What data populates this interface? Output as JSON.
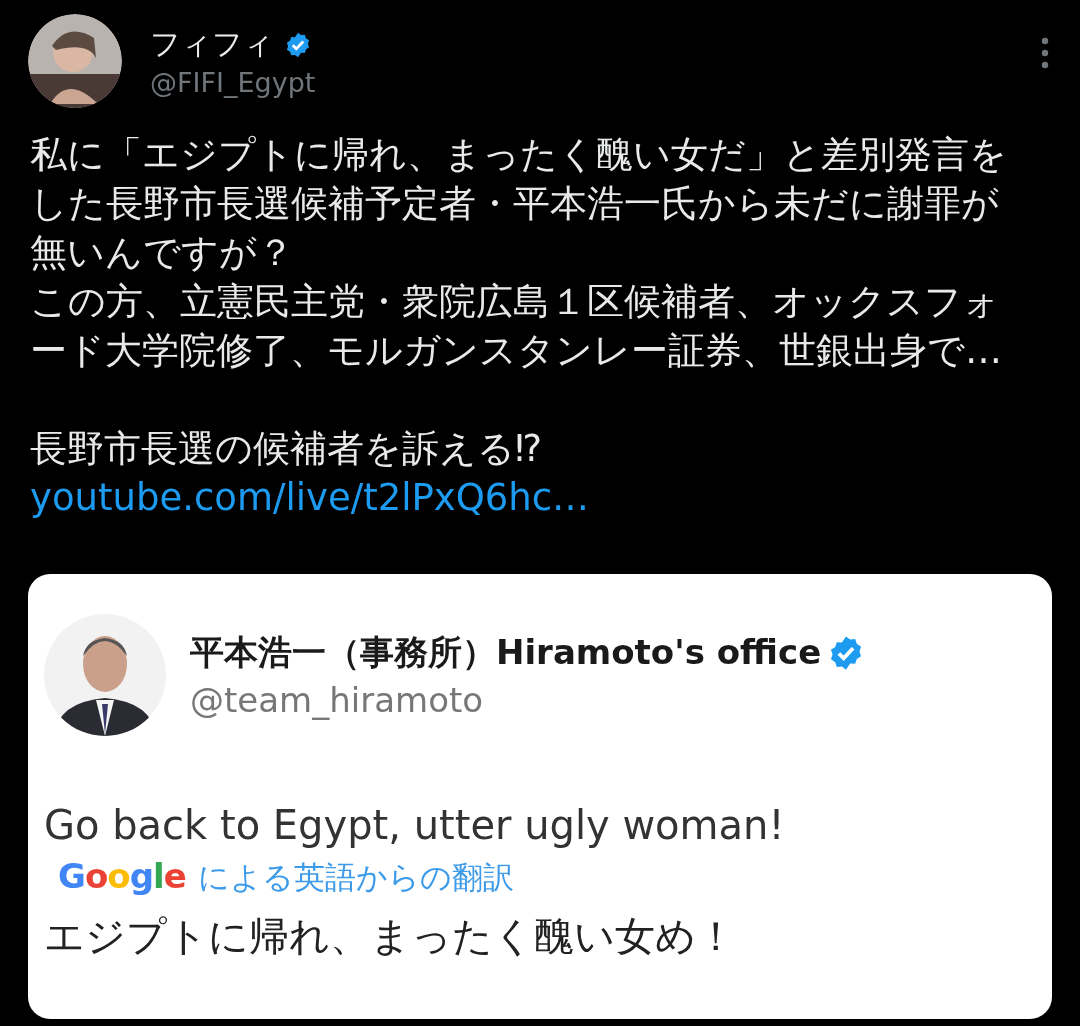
{
  "author": {
    "name": "フィフィ",
    "verified": true,
    "handle": "@FIFI_Egypt"
  },
  "tweet": {
    "paragraphs": [
      "私に「エジプトに帰れ、まったく醜い女だ」と差別発言をした長野市長選候補予定者・平本浩一氏から未だに謝罪が無いんですが？",
      "この方、立憲民主党・衆院広島１区候補者、オックスフォード大学院修了、モルガンスタンレー証券、世銀出身で…"
    ],
    "last_paragraph": "長野市長選の候補者を訴える⁉",
    "link": "youtube.com/live/t2lPxQ6hc…"
  },
  "quoted_screenshot": {
    "name": "平本浩一（事務所）Hiramoto's office",
    "verified": true,
    "handle": "@team_hiramoto",
    "text": "Go back to Egypt, utter ugly woman!",
    "translator": "Google",
    "translation_label": "による英語からの翻訳",
    "translation": "エジプトに帰れ、まったく醜い女め！"
  }
}
